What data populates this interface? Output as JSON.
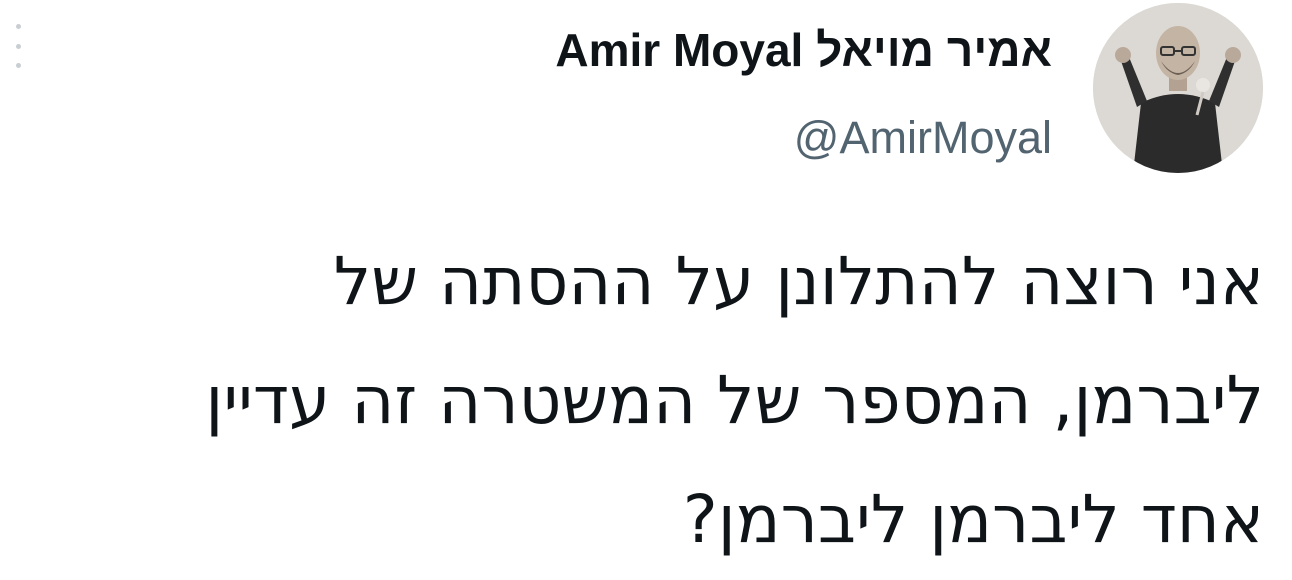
{
  "tweet": {
    "author": {
      "display_name": "Amir Moyal אמיר מויאל",
      "handle": "@AmirMoyal",
      "avatar_icon": "profile-photo"
    },
    "menu_icon": "more-vertical-icon",
    "text_lines": [
      "אני רוצה להתלונן על ההסתה של",
      "ליברמן, המספר של המשטרה זה עדיין",
      "אחד ליברמן ליברמן?"
    ]
  },
  "colors": {
    "text_primary": "#0f1419",
    "text_secondary": "#536471",
    "background": "#ffffff"
  }
}
